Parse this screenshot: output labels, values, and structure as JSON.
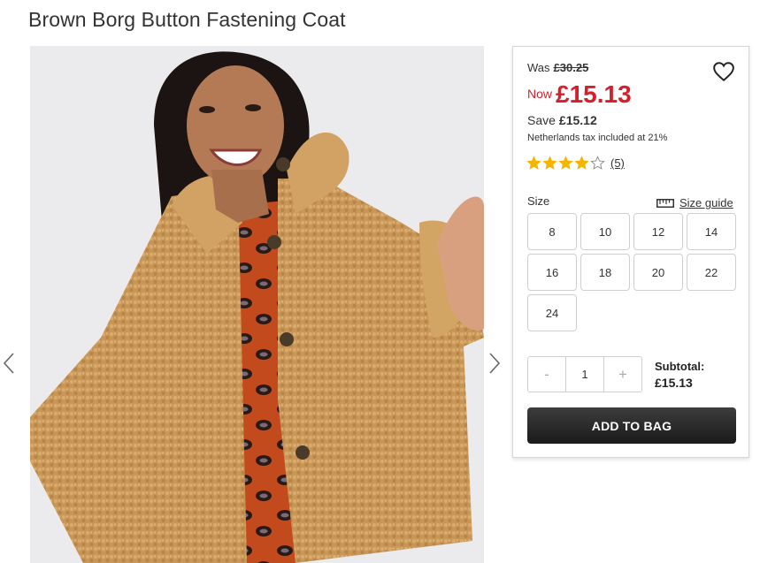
{
  "product": {
    "title": "Brown Borg Button Fastening Coat"
  },
  "pricing": {
    "was_label": "Was",
    "was_price": "£30.25",
    "now_label": "Now",
    "now_price": "£15.13",
    "save_label": "Save",
    "save_amount": "£15.12",
    "tax_note": "Netherlands tax included at 21%"
  },
  "rating": {
    "stars": 4,
    "max_stars": 5,
    "review_count": "(5)"
  },
  "size": {
    "label": "Size",
    "guide_label": "Size guide",
    "options": [
      "8",
      "10",
      "12",
      "14",
      "16",
      "18",
      "20",
      "22",
      "24"
    ]
  },
  "quantity": {
    "minus": "-",
    "value": "1",
    "plus": "+"
  },
  "subtotal": {
    "label": "Subtotal:",
    "amount": "£15.13"
  },
  "add_to_bag": {
    "label": "ADD TO BAG"
  },
  "colors": {
    "price_red": "#d4202a",
    "star_gold": "#f5b400",
    "button_dark": "#222222"
  },
  "icons": {
    "wishlist": "heart-icon",
    "size_guide": "ruler-icon",
    "prev": "chevron-left-icon",
    "next": "chevron-right-icon"
  }
}
